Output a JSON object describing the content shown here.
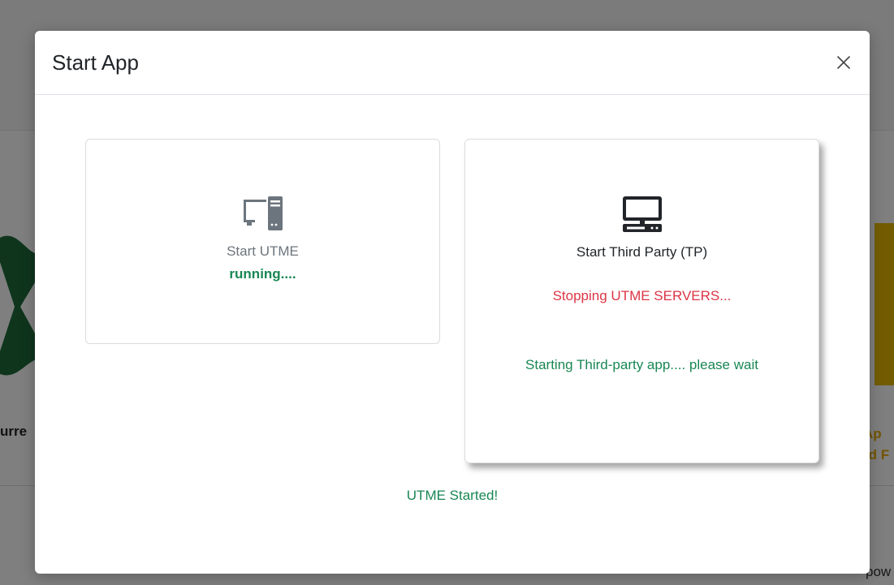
{
  "background": {
    "header_text": "",
    "left_caption": "urre",
    "right_caption_line1": "Ap",
    "right_caption_line2": "rd F",
    "footer_text": "pow"
  },
  "modal": {
    "title": "Start App",
    "close_icon": "close-icon",
    "utme_card": {
      "icon": "server-computer-icon",
      "label": "Start UTME",
      "status": "running...."
    },
    "tp_card": {
      "icon": "desktop-computer-icon",
      "label": "Start Third Party (TP)",
      "stopping_text": "Stopping UTME SERVERS...",
      "starting_text": "Starting Third-party app.... please wait"
    },
    "footer_status": "UTME Started!"
  },
  "colors": {
    "success": "#198754",
    "danger": "#dc3545",
    "muted": "#6c757d",
    "brand_yellow": "#e6b800",
    "brand_green": "#1e6b3a"
  }
}
